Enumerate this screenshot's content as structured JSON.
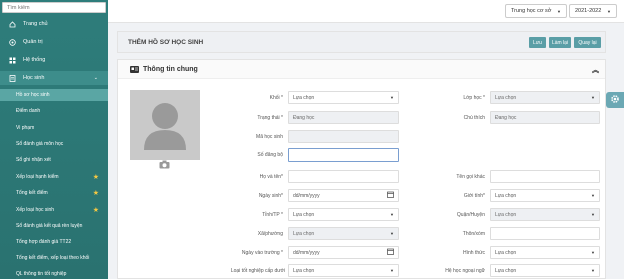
{
  "sidebar": {
    "search_placeholder": "Tìm kiếm",
    "items": [
      {
        "label": "Trang chủ",
        "icon": "home-icon"
      },
      {
        "label": "Quản trị",
        "icon": "settings-circle-icon"
      },
      {
        "label": "Hệ thống",
        "icon": "grid-icon"
      },
      {
        "label": "Học sinh",
        "icon": "student-icon"
      }
    ],
    "subitems": [
      {
        "label": "Hồ sơ học sinh",
        "active": true,
        "star": false
      },
      {
        "label": "Điểm danh",
        "star": false
      },
      {
        "label": "Vi phạm",
        "star": false
      },
      {
        "label": "Sổ đánh giá môn học",
        "star": false
      },
      {
        "label": "Sổ ghi nhận xét",
        "star": false
      },
      {
        "label": "Xếp loại hạnh kiểm",
        "star": true
      },
      {
        "label": "Tổng kết điểm",
        "star": true
      },
      {
        "label": "Xếp loại học sinh",
        "star": true
      },
      {
        "label": "Sổ đánh giá kết quả rèn luyện",
        "star": false
      },
      {
        "label": "Tổng hợp đánh giá TT22",
        "star": false
      },
      {
        "label": "Tổng kết điểm, xếp loại theo khối",
        "star": false
      },
      {
        "label": "QL thông tin tốt nghiệp",
        "star": false
      }
    ]
  },
  "topbar": {
    "level": "Trung học cơ sở",
    "year": "2021-2022"
  },
  "header": {
    "title": "THÊM HỒ SƠ HỌC SINH",
    "btn_save": "Lưu",
    "btn_reset": "Làm lại",
    "btn_back": "Quay lại",
    "colors": {
      "save": "#5a9ea6",
      "reset": "#5a9ea6",
      "back": "#5a9ea6"
    }
  },
  "section": {
    "title": "Thông tin chung"
  },
  "form": {
    "khoi": {
      "label": "Khối *",
      "value": "Lựa chọn"
    },
    "lop": {
      "label": "Lớp học *",
      "value": "Lựa chọn"
    },
    "trangthai": {
      "label": "Trạng thái *",
      "value": "Đang học"
    },
    "chuthich": {
      "label": "Chú thích",
      "value": "Đang học"
    },
    "mahs": {
      "label": "Mã học sinh",
      "value": ""
    },
    "sodangbo": {
      "label": "Số đăng bộ",
      "value": ""
    },
    "hoten": {
      "label": "Họ và tên*",
      "value": ""
    },
    "tengoikhac": {
      "label": "Tên gọi khác",
      "value": ""
    },
    "ngaysinh": {
      "label": "Ngày sinh*",
      "placeholder": "dd/mm/yyyy"
    },
    "gioitinh": {
      "label": "Giới tính*",
      "value": "Lựa chọn"
    },
    "tinh": {
      "label": "Tỉnh/TP *",
      "value": "Lựa chọn"
    },
    "quan": {
      "label": "Quận/Huyện",
      "value": "Lựa chọn"
    },
    "xa": {
      "label": "Xã/phường",
      "value": "Lựa chọn"
    },
    "thon": {
      "label": "Thôn/xóm",
      "value": ""
    },
    "ngayvao": {
      "label": "Ngày vào trường *",
      "placeholder": "dd/mm/yyyy"
    },
    "hinhthuc": {
      "label": "Hình thức",
      "value": "Lựa chọn"
    },
    "loaitn": {
      "label": "Loại tốt nghiệp cấp dưới",
      "value": "Lựa chọn"
    },
    "hengoaingu": {
      "label": "Hệ học ngoại ngữ",
      "value": "Lựa chọn"
    }
  }
}
